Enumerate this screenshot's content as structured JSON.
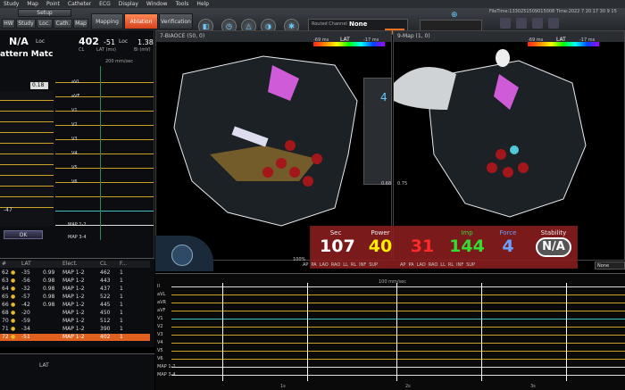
{
  "menu": [
    "Study",
    "Map",
    "Point",
    "Catheter",
    "ECG",
    "Display",
    "Window",
    "Tools",
    "Help"
  ],
  "toolbar": {
    "setup": "Setup",
    "tabs": [
      "HW",
      "Study",
      "Loc.",
      "Cath.",
      "Map"
    ],
    "mode_buttons": [
      {
        "label": "Mapping",
        "active": false
      },
      {
        "label": "Ablation",
        "active": true
      },
      {
        "label": "Verification",
        "active": false
      }
    ],
    "routed_channel_label": "Routed Channel",
    "routed_channel_value": "None",
    "file_info": "FileTime:1330251509015008 Time:2022 7 20 17 30 9 15"
  },
  "left_panel": {
    "na_label": "N/A",
    "loc_label": "Loc",
    "pattern_title": "attern Matc",
    "threshold": "0.18",
    "cl_value": "402",
    "cl_label": "CL",
    "lat_value": "-51",
    "lat_label": "LAT (ms)",
    "loc2": "Loc",
    "loc2_value": "1.38",
    "loc2_unit": "Bi (mV)",
    "sweep": "200 mm/sec",
    "trace_labels": [
      "aVL",
      "aVF",
      "V1",
      "V2",
      "V3",
      "V4",
      "V5",
      "V6",
      "MAP 1-2",
      "MAP 3-4"
    ],
    "lower_value": "-47",
    "ok_label": "OK"
  },
  "map1": {
    "title": "7-BIAOCE (50, 0)",
    "scale_min": "-69 ms",
    "scale_label": "LAT",
    "scale_max": "-17 ms",
    "side_value": "4",
    "mark_left": "0.68"
  },
  "map2": {
    "title": "9-Map (1, 0)",
    "scale_min": "-69 ms",
    "scale_label": "LAT",
    "scale_max": "-17 ms",
    "mark_left": "0.75",
    "dropdown": "None"
  },
  "ablation": {
    "sec_label": "Sec",
    "sec_value": "107",
    "power_label": "Power",
    "power_value": "40",
    "temp_value": "31",
    "imp_label": "Imp",
    "imp_value": "144",
    "force_label": "Force",
    "force_value": "4",
    "stability_label": "Stability",
    "stability_value": "N/A",
    "colors": {
      "sec": "#ffffff",
      "power": "#ffee00",
      "temp": "#ff2a2a",
      "imp": "#33dd33",
      "force": "#6aa0ff"
    },
    "view_row1": [
      "AP",
      "PA",
      "LAO",
      "RAO",
      "LL",
      "RL",
      "INF",
      "SUP"
    ],
    "view_row2": [
      "AP",
      "PA",
      "LAO",
      "RAO",
      "LL",
      "RL",
      "INF",
      "SUP"
    ],
    "percent": "100%"
  },
  "table": {
    "headers": [
      "#",
      "",
      "LAT",
      "",
      "Elect.",
      "CL",
      "F..."
    ],
    "rows": [
      {
        "n": "62",
        "lat": "-35",
        "v": "0.99",
        "elect": "MAP 1-2",
        "cl": "462",
        "f": "1"
      },
      {
        "n": "63",
        "lat": "-56",
        "v": "0.98",
        "elect": "MAP 1-2",
        "cl": "443",
        "f": "1"
      },
      {
        "n": "64",
        "lat": "-32",
        "v": "0.98",
        "elect": "MAP 1-2",
        "cl": "437",
        "f": "1"
      },
      {
        "n": "65",
        "lat": "-57",
        "v": "0.98",
        "elect": "MAP 1-2",
        "cl": "522",
        "f": "1"
      },
      {
        "n": "66",
        "lat": "-42",
        "v": "0.98",
        "elect": "MAP 1-2",
        "cl": "445",
        "f": "1"
      },
      {
        "n": "68",
        "lat": "-20",
        "v": "",
        "elect": "MAP 1-2",
        "cl": "450",
        "f": "1"
      },
      {
        "n": "70",
        "lat": "-59",
        "v": "",
        "elect": "MAP 1-2",
        "cl": "512",
        "f": "1"
      },
      {
        "n": "71",
        "lat": "-34",
        "v": "",
        "elect": "MAP 1-2",
        "cl": "390",
        "f": "1"
      },
      {
        "n": "72",
        "lat": "-51",
        "v": "",
        "elect": "MAP 1-2",
        "cl": "402",
        "f": "1",
        "selected": true
      }
    ]
  },
  "bottom_left": {
    "lat_label": "LAT"
  },
  "ecg": {
    "sweep": "100 mm/sec",
    "lead_labels": [
      "II",
      "aVL",
      "aVR",
      "aVF",
      "V1",
      "V2",
      "V3",
      "V4",
      "V5",
      "V6",
      "MAP 1-2",
      "MAP 3-4"
    ],
    "time_labels": [
      "1s",
      "2s",
      "3s"
    ]
  }
}
